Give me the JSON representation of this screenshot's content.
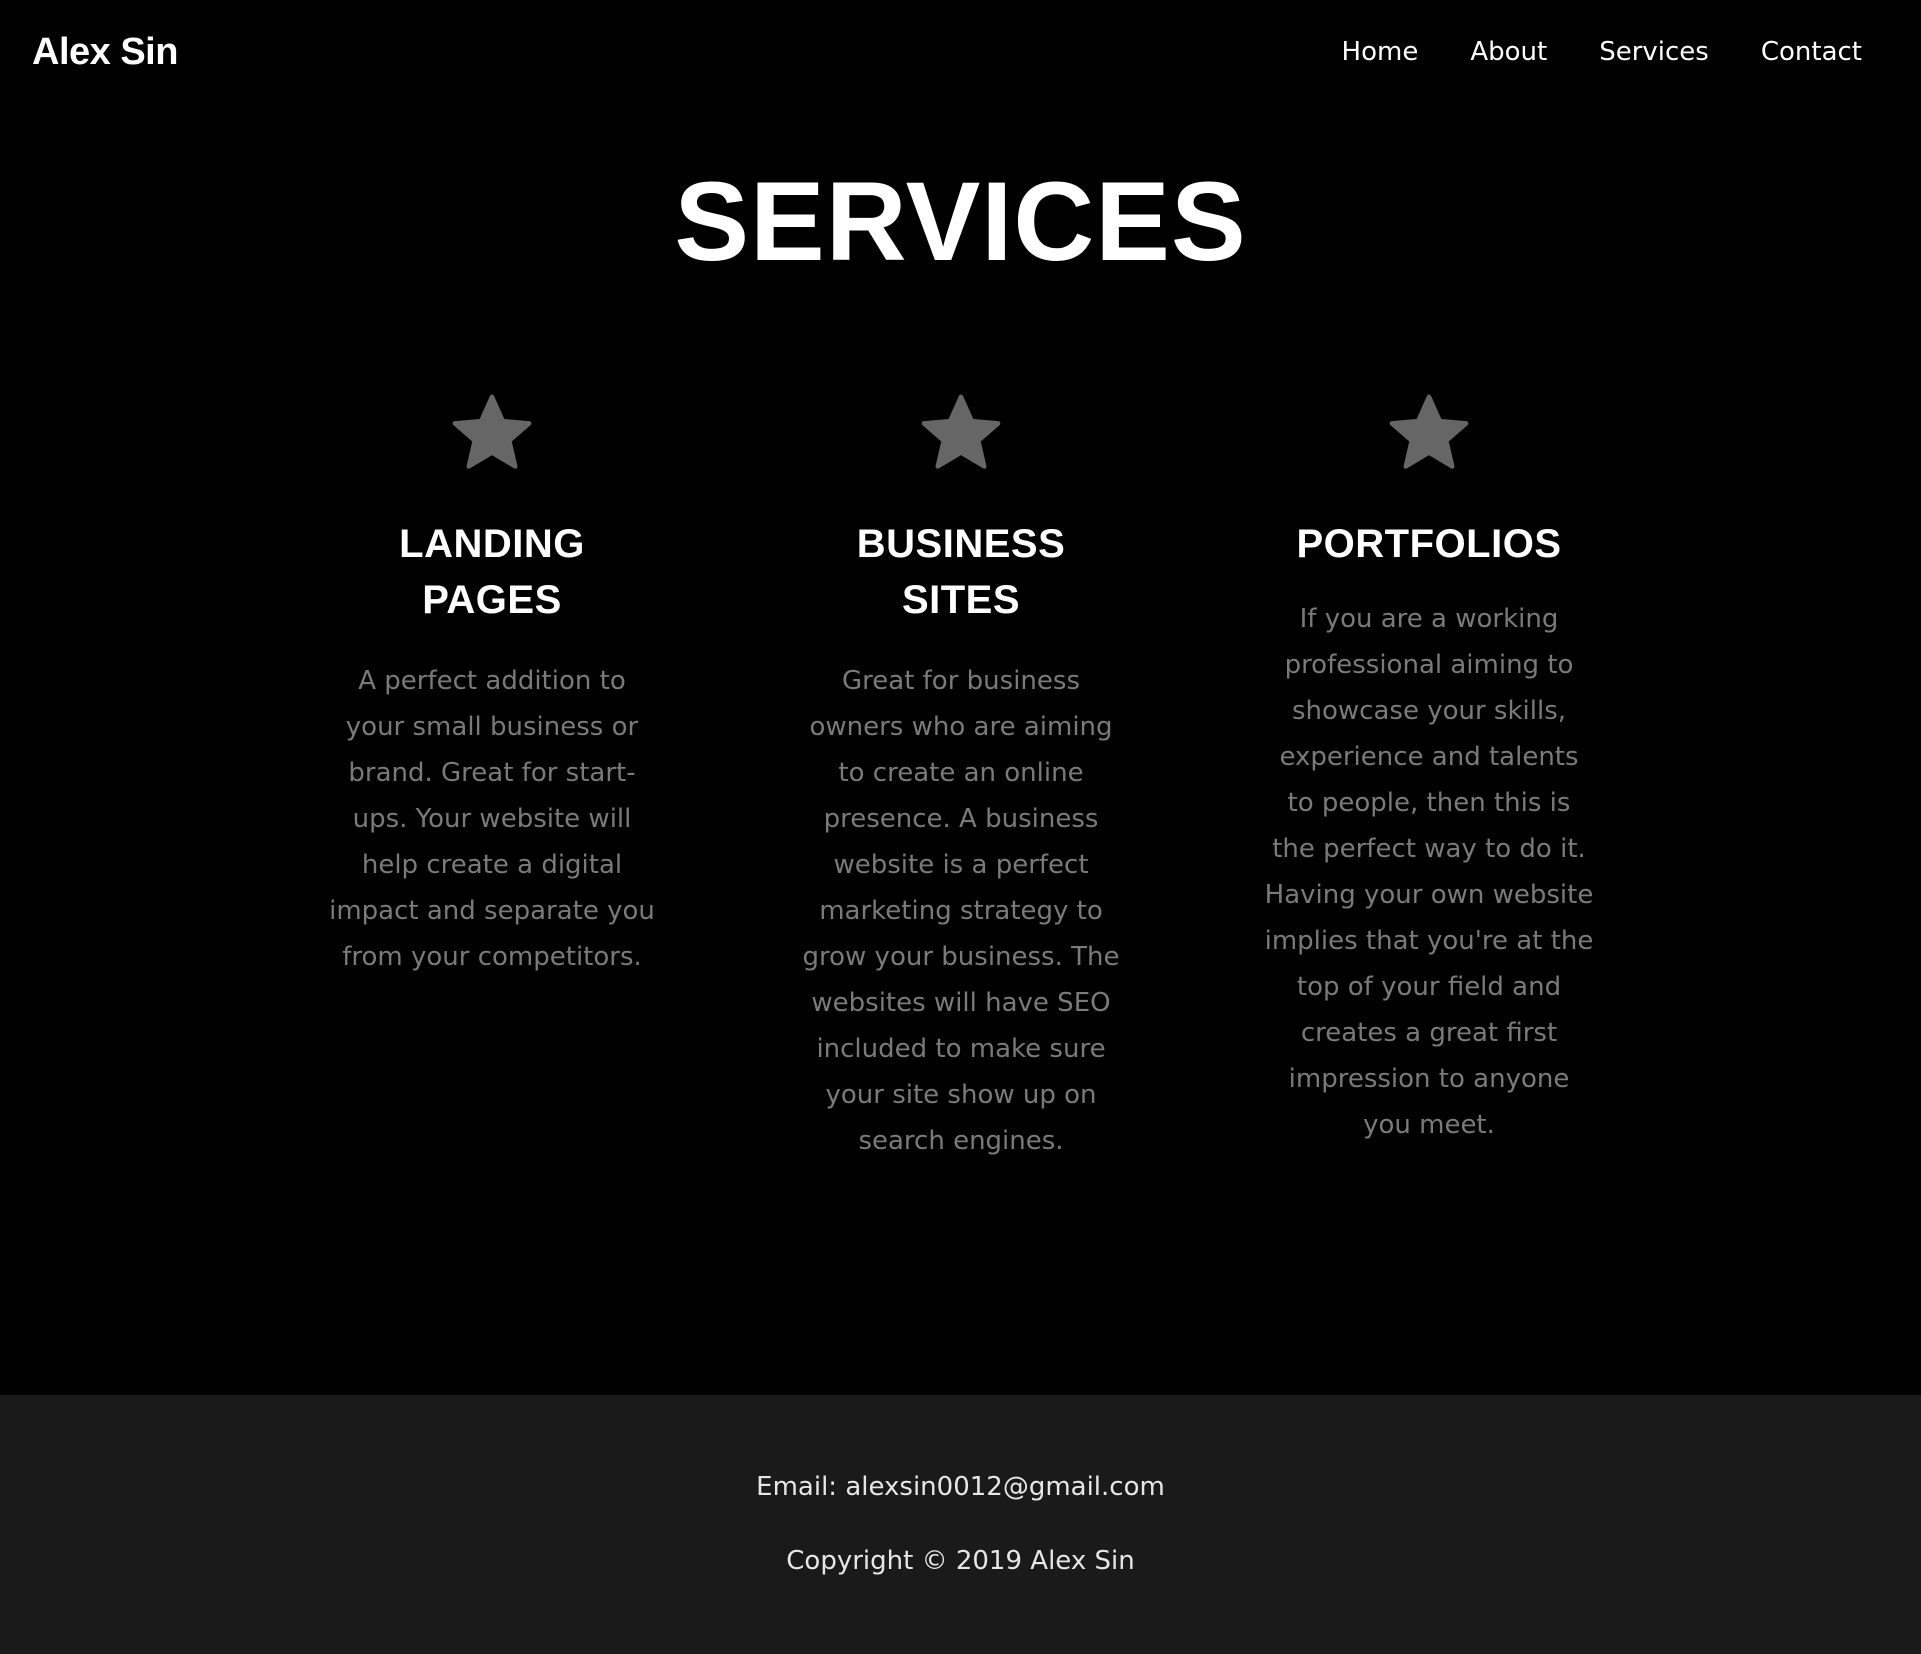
{
  "nav": {
    "brand": "Alex Sin",
    "links": [
      {
        "label": "Home"
      },
      {
        "label": "About"
      },
      {
        "label": "Services"
      },
      {
        "label": "Contact"
      }
    ]
  },
  "page": {
    "title": "SERVICES"
  },
  "services": [
    {
      "icon": "star-icon",
      "title": "LANDING PAGES",
      "description": "A perfect addition to your small business or brand. Great for start-ups. Your website will help create a digital impact and separate you from your competitors."
    },
    {
      "icon": "star-icon",
      "title": "BUSINESS SITES",
      "description": "Great for business owners who are aiming to create an online presence. A business website is a perfect marketing strategy to grow your business. The websites will have SEO included to make sure your site show up on search engines."
    },
    {
      "icon": "star-icon",
      "title": "PORTFOLIOS",
      "description": "If you are a working professional aiming to showcase your skills, experience and talents to people, then this is the perfect way to do it. Having your own website implies that you're at the top of your field and creates a great first impression to anyone you meet."
    }
  ],
  "footer": {
    "email": "Email: alexsin0012@gmail.com",
    "copyright": "Copyright © 2019 Alex Sin"
  },
  "colors": {
    "background": "#000000",
    "footer_background": "#1a1a1a",
    "text_primary": "#ffffff",
    "text_muted": "#7a7a7a",
    "icon": "#666666"
  }
}
